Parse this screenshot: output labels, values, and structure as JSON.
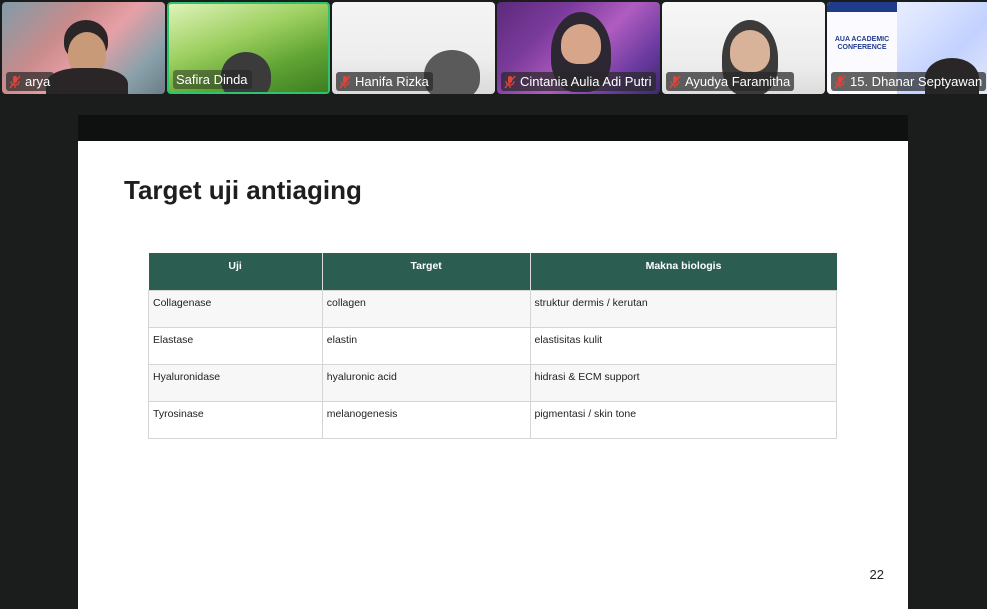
{
  "participants": [
    {
      "name": "arya",
      "muted": true,
      "active": false
    },
    {
      "name": "Safira Dinda",
      "muted": false,
      "active": true
    },
    {
      "name": "Hanifa Rizka",
      "muted": true,
      "active": false
    },
    {
      "name": "Cintania Aulia Adi Putri",
      "muted": true,
      "active": false
    },
    {
      "name": "Ayudya Faramitha",
      "muted": true,
      "active": false
    },
    {
      "name": "15. Dhanar Septyawan",
      "muted": true,
      "active": false
    }
  ],
  "poster_text": "AUA ACADEMIC CONFERENCE",
  "slide": {
    "title": "Target uji antiaging",
    "page_number": "22",
    "table": {
      "headers": [
        "Uji",
        "Target",
        "Makna biologis"
      ],
      "rows": [
        [
          "Collagenase",
          "collagen",
          "struktur dermis / kerutan"
        ],
        [
          "Elastase",
          "elastin",
          "elastisitas kulit"
        ],
        [
          "Hyaluronidase",
          "hyaluronic acid",
          "hidrasi & ECM support"
        ],
        [
          "Tyrosinase",
          "melanogenesis",
          "pigmentasi / skin tone"
        ]
      ]
    }
  },
  "colors": {
    "header_bg": "#2b5e51",
    "active_speaker_border": "#2ec46d",
    "muted_icon": "#e0443a"
  },
  "icons": {
    "muted": "mic-muted-icon"
  }
}
